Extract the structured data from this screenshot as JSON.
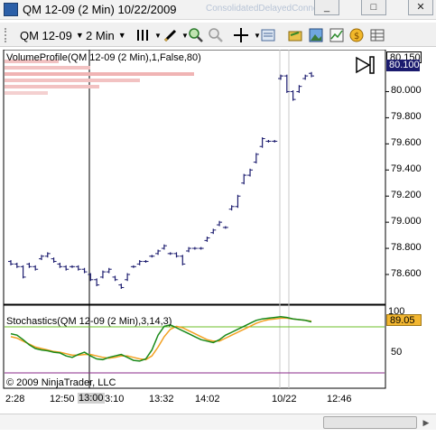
{
  "window": {
    "title": "QM 12-09 (2 Min)  10/22/2009",
    "faded_background_text": "ConsolidatedDelayedConnection",
    "minimize_label": "_",
    "restore_label": "□",
    "close_label": "✕"
  },
  "toolbar": {
    "instrument": "QM 12-09",
    "period": "2 Min",
    "icons": [
      "bar-style-icon",
      "pencil-icon",
      "zoom-in-icon",
      "zoom-out-icon",
      "crosshair-icon",
      "data-box-icon",
      "folder-icon",
      "image-icon",
      "chart-icon",
      "coin-icon",
      "grid-icon"
    ]
  },
  "chart": {
    "volume_profile_label": "VolumeProfile(QM 12-09 (2 Min),1,False,80)",
    "stochastics_label": "Stochastics(QM 12-09 (2 Min),3,14,3)",
    "copyright": "© 2009 NinjaTrader, LLC",
    "price_tag_top": "80.150",
    "price_tag_current": "80.100",
    "stoch_value": "89.05",
    "price_axis_labels": [
      "80.000",
      "79.800",
      "79.600",
      "79.400",
      "79.200",
      "79.000",
      "78.800",
      "78.600"
    ],
    "stoch_axis_labels": [
      "100",
      "50"
    ],
    "time_labels": [
      "2:28",
      "12:50",
      "13:00",
      "3:10",
      "13:32",
      "14:02",
      "10/22",
      "12:46"
    ],
    "colors": {
      "bars": "#1b1b6e",
      "stoch_k": "#1a8a1a",
      "stoch_d": "#f2a020",
      "upper_line": "#6cbf2a",
      "lower_line": "#8a2a8a",
      "volume_profile": "#f0b4b4"
    }
  },
  "chart_data": {
    "type": "line",
    "title": "QM 12-09 (2 Min)  10/22/2009",
    "price_range": [
      78.45,
      80.2
    ],
    "stoch_range": [
      0,
      100
    ],
    "bars": [
      {
        "o": 78.7,
        "c": 78.68
      },
      {
        "o": 78.68,
        "c": 78.66
      },
      {
        "o": 78.66,
        "c": 78.58
      },
      {
        "o": 78.68,
        "c": 78.66
      },
      {
        "o": 78.66,
        "c": 78.64
      },
      {
        "o": 78.72,
        "c": 78.74
      },
      {
        "o": 78.74,
        "c": 78.76
      },
      {
        "o": 78.72,
        "c": 78.7
      },
      {
        "o": 78.68,
        "c": 78.66
      },
      {
        "o": 78.66,
        "c": 78.64
      },
      {
        "o": 78.66,
        "c": 78.66
      },
      {
        "o": 78.66,
        "c": 78.64
      },
      {
        "o": 78.64,
        "c": 78.62
      },
      {
        "o": 78.6,
        "c": 78.56
      },
      {
        "o": 78.56,
        "c": 78.52
      },
      {
        "o": 78.58,
        "c": 78.62
      },
      {
        "o": 78.62,
        "c": 78.64
      },
      {
        "o": 78.58,
        "c": 78.56
      },
      {
        "o": 78.52,
        "c": 78.5
      },
      {
        "o": 78.56,
        "c": 78.6
      },
      {
        "o": 78.66,
        "c": 78.66
      },
      {
        "o": 78.68,
        "c": 78.7
      },
      {
        "o": 78.7,
        "c": 78.7
      },
      {
        "o": 78.74,
        "c": 78.74
      },
      {
        "o": 78.76,
        "c": 78.78
      },
      {
        "o": 78.8,
        "c": 78.82
      },
      {
        "o": 78.76,
        "c": 78.76
      },
      {
        "o": 78.76,
        "c": 78.74
      },
      {
        "o": 78.74,
        "c": 78.68
      },
      {
        "o": 78.78,
        "c": 78.8
      },
      {
        "o": 78.8,
        "c": 78.8
      },
      {
        "o": 78.8,
        "c": 78.8
      },
      {
        "o": 78.86,
        "c": 78.88
      },
      {
        "o": 78.92,
        "c": 78.94
      },
      {
        "o": 78.98,
        "c": 79.0
      },
      {
        "o": 78.96,
        "c": 78.96
      },
      {
        "o": 79.1,
        "c": 79.12
      },
      {
        "o": 79.12,
        "c": 79.2
      },
      {
        "o": 79.3,
        "c": 79.36
      },
      {
        "o": 79.36,
        "c": 79.4
      },
      {
        "o": 79.46,
        "c": 79.52
      },
      {
        "o": 79.58,
        "c": 79.64
      },
      {
        "o": 79.62,
        "c": 79.62
      },
      {
        "o": 79.62,
        "c": 79.62
      },
      {
        "o": 80.1,
        "c": 80.12
      },
      {
        "o": 80.12,
        "c": 80.0
      },
      {
        "o": 80.0,
        "c": 79.94
      },
      {
        "o": 80.0,
        "c": 80.04
      },
      {
        "o": 80.1,
        "c": 80.12
      },
      {
        "o": 80.14,
        "c": 80.12
      }
    ],
    "stoch_k": [
      70,
      68,
      62,
      55,
      50,
      48,
      47,
      45,
      44,
      40,
      38,
      42,
      45,
      40,
      36,
      35,
      38,
      40,
      42,
      38,
      34,
      33,
      36,
      48,
      68,
      80,
      82,
      78,
      74,
      70,
      66,
      62,
      60,
      58,
      62,
      68,
      72,
      76,
      80,
      84,
      88,
      90,
      91,
      92,
      93,
      92,
      90,
      89,
      88,
      86
    ],
    "stoch_d": [
      66,
      64,
      60,
      56,
      52,
      50,
      48,
      46,
      45,
      43,
      41,
      41,
      42,
      42,
      40,
      38,
      37,
      38,
      40,
      40,
      38,
      36,
      35,
      40,
      52,
      66,
      76,
      80,
      78,
      74,
      70,
      66,
      62,
      60,
      60,
      64,
      68,
      72,
      76,
      80,
      84,
      87,
      89,
      90,
      91,
      91,
      90,
      89,
      88,
      87
    ]
  }
}
